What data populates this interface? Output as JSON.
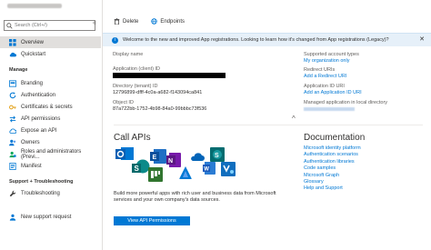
{
  "sidebar": {
    "search_placeholder": "Search (Ctrl+/)",
    "collapse_glyph": "«",
    "items": [
      {
        "label": "Overview",
        "icon": "grid-icon",
        "color": "#0078d4"
      },
      {
        "label": "Quickstart",
        "icon": "cloud-icon",
        "color": "#0078d4"
      }
    ],
    "sections": [
      {
        "heading": "Manage",
        "items": [
          {
            "label": "Branding",
            "icon": "branding-icon",
            "color": "#0078d4"
          },
          {
            "label": "Authentication",
            "icon": "refresh-icon",
            "color": "#0078d4"
          },
          {
            "label": "Certificates & secrets",
            "icon": "key-icon",
            "color": "#e3a21a"
          },
          {
            "label": "API permissions",
            "icon": "arrows-icon",
            "color": "#0078d4"
          },
          {
            "label": "Expose an API",
            "icon": "cloud-api-icon",
            "color": "#0078d4"
          },
          {
            "label": "Owners",
            "icon": "people-icon",
            "color": "#0078d4"
          },
          {
            "label": "Roles and administrators (Previ...",
            "icon": "roles-icon",
            "color": "#00a65a"
          },
          {
            "label": "Manifest",
            "icon": "manifest-icon",
            "color": "#0078d4"
          }
        ]
      },
      {
        "heading": "Support + Troubleshooting",
        "items": [
          {
            "label": "Troubleshooting",
            "icon": "wrench-icon",
            "color": "#323130"
          },
          {
            "label": "New support request",
            "icon": "support-person-icon",
            "color": "#0078d4"
          }
        ]
      }
    ]
  },
  "toolbar": {
    "delete_label": "Delete",
    "endpoints_label": "Endpoints"
  },
  "banner": {
    "text": "Welcome to the new and improved App registrations. Looking to learn how it's changed from App registrations (Legacy)?",
    "close": "✕"
  },
  "essentials": {
    "display_name_label": "Display name",
    "app_id_label": "Application (client) ID",
    "tenant_label": "Directory (tenant) ID",
    "tenant_value": "12796899-dfff-4c0a-a682-f143094ca841",
    "object_label": "Object ID",
    "object_value": "87a722bb-1752-4b98-84a0-99bbbc73f536",
    "account_types_label": "Supported account types",
    "account_types_value": "My organization only",
    "redirect_label": "Redirect URIs",
    "redirect_value": "Add a Redirect URI",
    "app_uri_label": "Application ID URI",
    "app_uri_value": "Add an Application ID URI",
    "managed_label": "Managed application in local directory",
    "chevron": "^"
  },
  "call_apis": {
    "title": "Call APIs",
    "description": "Build more powerful apps with rich user and business data from Microsoft services and your own company's data sources.",
    "button": "View API Permissions"
  },
  "documentation": {
    "title": "Documentation",
    "links": [
      "Microsoft identity platform",
      "Authentication scenarios",
      "Authentication libraries",
      "Code samples",
      "Microsoft Graph",
      "Glossary",
      "Help and Support"
    ]
  }
}
